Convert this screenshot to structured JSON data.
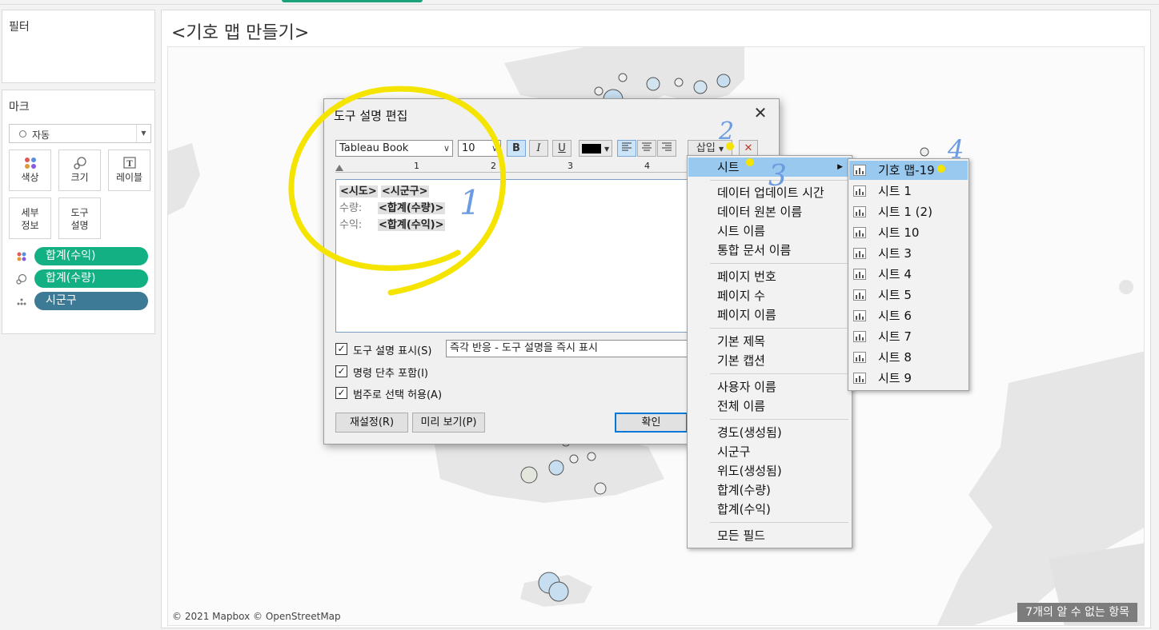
{
  "filters": {
    "title": "필터"
  },
  "marks": {
    "title": "마크",
    "mark_type": "자동",
    "buttons": [
      {
        "label": "색상",
        "icon": "color-dots-icon"
      },
      {
        "label": "크기",
        "icon": "size-icon"
      },
      {
        "label": "레이블",
        "icon": "label-icon"
      },
      {
        "label": "세부\n정보",
        "icon": "detail-icon"
      },
      {
        "label": "도구\n설명",
        "icon": "tooltip-icon"
      }
    ],
    "pills": [
      {
        "label": "합계(수익)",
        "kind": "color",
        "color": "#13b083"
      },
      {
        "label": "합계(수량)",
        "kind": "size",
        "color": "#13b083"
      },
      {
        "label": "시군구",
        "kind": "detail",
        "color": "#3d7a96"
      }
    ]
  },
  "sheet": {
    "title": "<기호 맵 만들기>",
    "attribution": "© 2021 Mapbox © OpenStreetMap",
    "unknown_items": "7개의 알 수 없는 항목"
  },
  "dialog": {
    "title": "도구 설명 편집",
    "font": "Tableau Book",
    "size": "10",
    "bold": "B",
    "italic": "I",
    "underline": "U",
    "insert_label": "삽입",
    "ruler": [
      "1",
      "2",
      "3",
      "4"
    ],
    "editor": {
      "line1_a": "<시도>",
      "line1_b": "<시군구>",
      "line2_label": "수량:",
      "line2_value": "<합계(수량)>",
      "line3_label": "수익:",
      "line3_value": "<합계(수익)>"
    },
    "show_tooltip": "도구 설명 표시(S)",
    "timing": "즉각 반응 - 도구 설명을 즉시 표시",
    "include_commands": "명령 단추 포함(I)",
    "allow_legend": "범주로 선택 허용(A)",
    "reset": "재설정(R)",
    "preview": "미리 보기(P)",
    "ok": "확인"
  },
  "insert_menu": {
    "sheet": "시트",
    "groups": [
      [
        "데이터 업데이트 시간",
        "데이터 원본 이름",
        "시트 이름",
        "통합 문서 이름"
      ],
      [
        "페이지 번호",
        "페이지 수",
        "페이지 이름"
      ],
      [
        "기본 제목",
        "기본 캡션"
      ],
      [
        "사용자 이름",
        "전체 이름"
      ],
      [
        "경도(생성됨)",
        "시군구",
        "위도(생성됨)",
        "합계(수량)",
        "합계(수익)"
      ],
      [
        "모든 필드"
      ]
    ]
  },
  "sheet_menu": [
    "기호 맵-19",
    "시트 1",
    "시트 1 (2)",
    "시트 10",
    "시트 3",
    "시트 4",
    "시트 5",
    "시트 6",
    "시트 7",
    "시트 8",
    "시트 9"
  ],
  "annotations": [
    "1",
    "2",
    "3",
    "4"
  ]
}
